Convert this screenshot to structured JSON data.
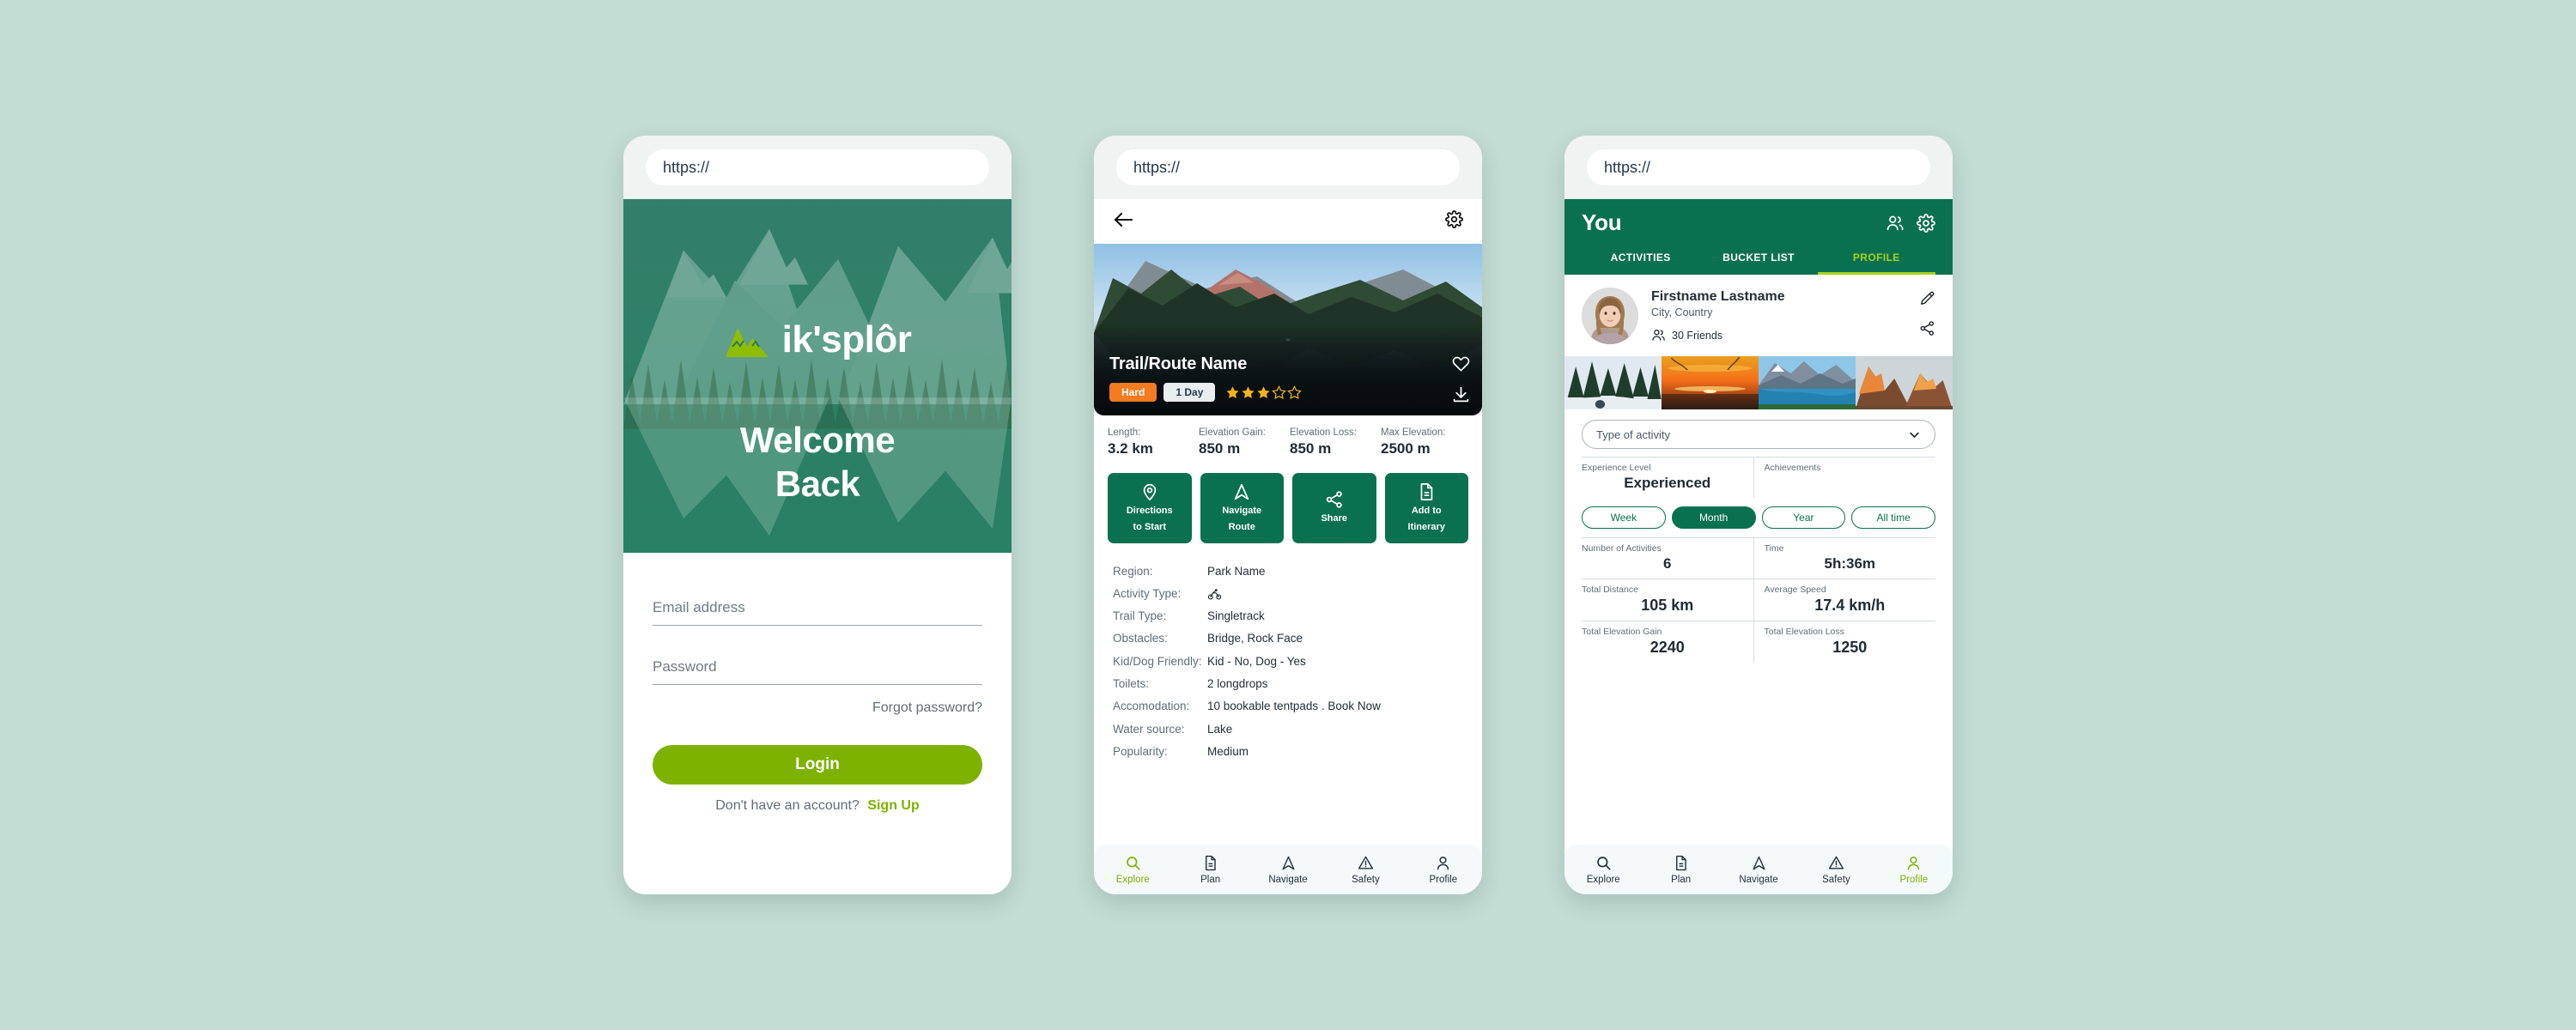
{
  "theme": {
    "page_background": "#c3dcd4",
    "brand_green_dark": "#0a7150",
    "brand_green_teal": "#2e8268",
    "brand_lime": "#7db200",
    "accent_lime_bright": "#a8cf1f",
    "badge_orange": "#f47b20",
    "star_gold": "#f6b21b"
  },
  "browser": {
    "url_placeholder": "https://"
  },
  "login_screen": {
    "brand_name": "ik'splôr",
    "logo_icon": "mountain-logo-icon",
    "welcome_line1": "Welcome",
    "welcome_line2": "Back",
    "email_placeholder": "Email address",
    "email_value": "",
    "password_placeholder": "Password",
    "password_value": "",
    "forgot_password_label": "Forgot password?",
    "login_button_label": "Login",
    "signup_prompt": "Don't have an account?",
    "signup_link_label": "Sign Up"
  },
  "trail_screen": {
    "back_icon": "arrow-left-icon",
    "settings_icon": "gear-icon",
    "hero_image_alt": "mountain-lake-photo",
    "trail_name": "Trail/Route Name",
    "difficulty_badge": "Hard",
    "duration_badge": "1 Day",
    "rating": 3,
    "rating_max": 5,
    "favorite_icon": "heart-icon",
    "download_icon": "download-icon",
    "stats": [
      {
        "label": "Length:",
        "value": "3.2 km"
      },
      {
        "label": "Elevation Gain:",
        "value": "850 m"
      },
      {
        "label": "Elevation Loss:",
        "value": "850 m"
      },
      {
        "label": "Max Elevation:",
        "value": "2500 m"
      }
    ],
    "actions": [
      {
        "icon": "map-pin-icon",
        "line1": "Directions",
        "line2": "to Start"
      },
      {
        "icon": "navigation-arrow-icon",
        "line1": "Navigate",
        "line2": "Route"
      },
      {
        "icon": "share-icon",
        "line1": "Share",
        "line2": ""
      },
      {
        "icon": "document-icon",
        "line1": "Add to",
        "line2": "Itinerary"
      }
    ],
    "details": [
      {
        "label": "Region:",
        "value": "Park Name",
        "icon": ""
      },
      {
        "label": "Activity Type:",
        "value": "",
        "icon": "bicycle-icon"
      },
      {
        "label": "Trail Type:",
        "value": "Singletrack",
        "icon": ""
      },
      {
        "label": "Obstacles:",
        "value": "Bridge, Rock Face",
        "icon": ""
      },
      {
        "label": "Kid/Dog Friendly:",
        "value": "Kid - No, Dog - Yes",
        "icon": ""
      },
      {
        "label": "Toilets:",
        "value": "2 longdrops",
        "icon": ""
      },
      {
        "label": "Accomodation:",
        "value": "10 bookable tentpads . Book Now",
        "icon": ""
      },
      {
        "label": "Water source:",
        "value": "Lake",
        "icon": ""
      },
      {
        "label": "Popularity:",
        "value": "Medium",
        "icon": ""
      }
    ]
  },
  "profile_screen": {
    "header_title": "You",
    "friends_header_icon": "people-icon",
    "settings_icon": "gear-icon",
    "tabs": [
      {
        "label": "ACTIVITIES",
        "active": false
      },
      {
        "label": "BUCKET LIST",
        "active": false
      },
      {
        "label": "PROFILE",
        "active": true
      }
    ],
    "avatar_icon": "user-avatar-photo",
    "user_name": "Firstname Lastname",
    "user_location": "City, Country",
    "friends_icon": "people-icon",
    "friends_count_label": "30 Friends",
    "edit_icon": "pencil-icon",
    "share_icon": "share-icon",
    "photos": [
      {
        "alt": "snowy-forest-photo"
      },
      {
        "alt": "orange-sunset-photo"
      },
      {
        "alt": "mountain-lake-photo"
      },
      {
        "alt": "golden-peaks-photo"
      }
    ],
    "activity_select_value": "Type of activity",
    "activity_select_icon": "chevron-down-icon",
    "summary_row": [
      {
        "label": "Experience Level",
        "value": "Experienced"
      },
      {
        "label": "Achievements",
        "value": ""
      }
    ],
    "periods": [
      {
        "label": "Week",
        "active": false
      },
      {
        "label": "Month",
        "active": true
      },
      {
        "label": "Year",
        "active": false
      },
      {
        "label": "All time",
        "active": false
      }
    ],
    "stats_grid": [
      [
        {
          "label": "Number of Activities",
          "value": "6"
        },
        {
          "label": "Time",
          "value": "5h:36m"
        }
      ],
      [
        {
          "label": "Total Distance",
          "value": "105 km"
        },
        {
          "label": "Average Speed",
          "value": "17.4 km/h"
        }
      ],
      [
        {
          "label": "Total Elevation Gain",
          "value": "2240"
        },
        {
          "label": "Total Elevation Loss",
          "value": "1250"
        }
      ]
    ]
  },
  "bottom_nav": [
    {
      "icon": "search-icon",
      "label": "Explore"
    },
    {
      "icon": "document-icon",
      "label": "Plan"
    },
    {
      "icon": "navigation-arrow-icon",
      "label": "Navigate"
    },
    {
      "icon": "warning-triangle-icon",
      "label": "Safety"
    },
    {
      "icon": "person-icon",
      "label": "Profile"
    }
  ]
}
